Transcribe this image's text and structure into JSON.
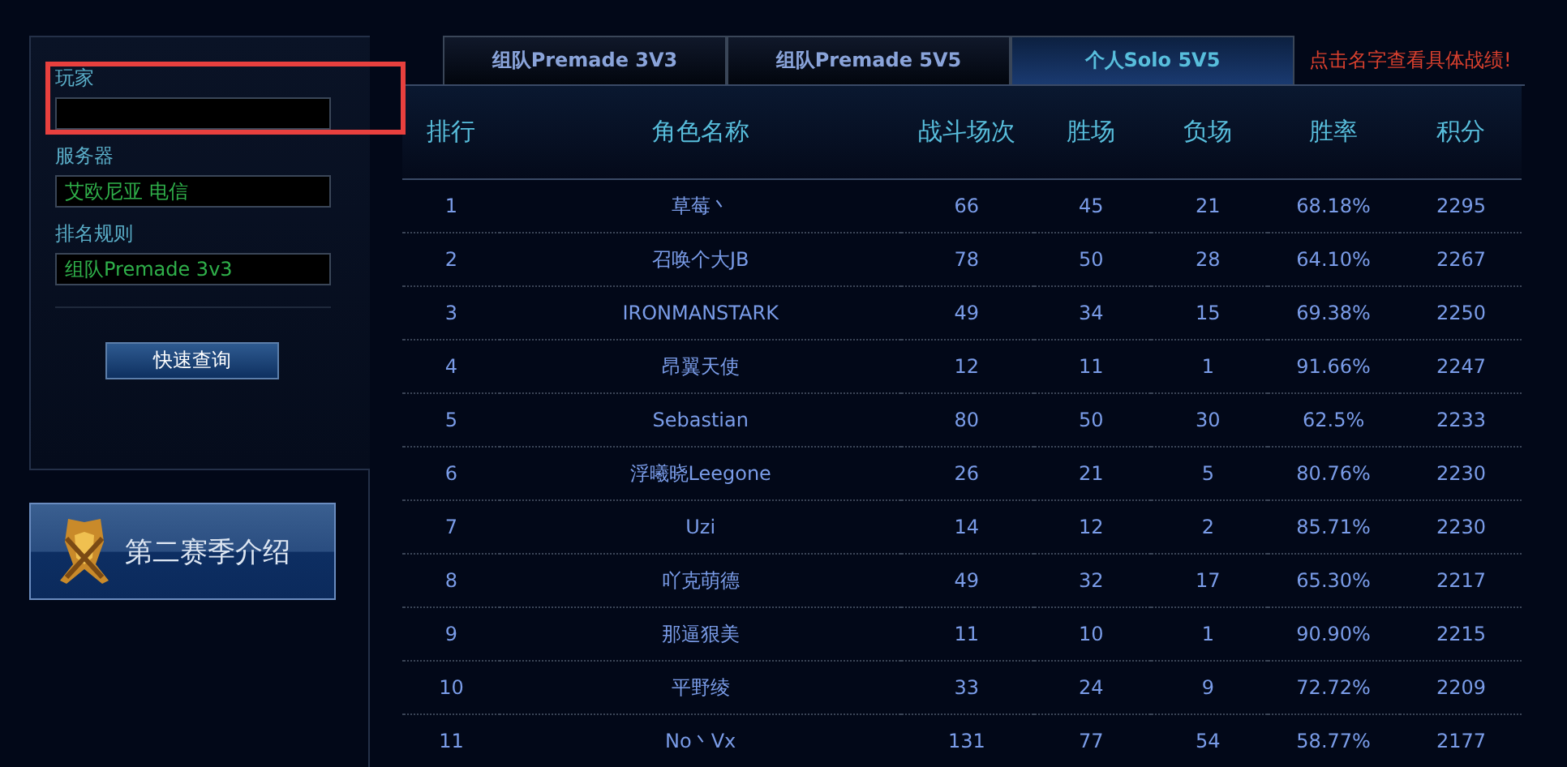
{
  "search_form": {
    "fields": [
      {
        "label": "玩家",
        "highlighted": true
      },
      {
        "label": "服务器",
        "value": "艾欧尼亚 电信",
        "highlighted": false
      },
      {
        "label": "排名规则",
        "value": "组队Premade 3v3",
        "highlighted": false
      }
    ],
    "button": "快速查询"
  },
  "season_intro": {
    "label": "第二赛季介绍"
  },
  "tabs": [
    {
      "label": "组队Premade 3V3",
      "selected": false
    },
    {
      "label": "组队Premade 5V5",
      "selected": false
    },
    {
      "label": "个人Solo 5V5",
      "selected": true
    }
  ],
  "hint": "点击名字查看具体战绩!",
  "table": {
    "columns": [
      "排行",
      "角色名称",
      "战斗场次",
      "胜场",
      "负场",
      "胜率",
      "积分"
    ],
    "rows": [
      [
        "1",
        "草莓丶",
        "66",
        "45",
        "21",
        "68.18%",
        "2295"
      ],
      [
        "2",
        "召唤个大JB",
        "78",
        "50",
        "28",
        "64.10%",
        "2267"
      ],
      [
        "3",
        "IRONMANSTARK",
        "49",
        "34",
        "15",
        "69.38%",
        "2250"
      ],
      [
        "4",
        "昂翼天使",
        "12",
        "11",
        "1",
        "91.66%",
        "2247"
      ],
      [
        "5",
        "Sebastian",
        "80",
        "50",
        "30",
        "62.5%",
        "2233"
      ],
      [
        "6",
        "浮曦晓Leegone",
        "26",
        "21",
        "5",
        "80.76%",
        "2230"
      ],
      [
        "7",
        "Uzi",
        "14",
        "12",
        "2",
        "85.71%",
        "2230"
      ],
      [
        "8",
        "吖克萌德",
        "49",
        "32",
        "17",
        "65.30%",
        "2217"
      ],
      [
        "9",
        "那逼狠美",
        "11",
        "10",
        "1",
        "90.90%",
        "2215"
      ],
      [
        "10",
        "平野绫",
        "33",
        "24",
        "9",
        "72.72%",
        "2209"
      ],
      [
        "11",
        "No丶Vx",
        "131",
        "77",
        "54",
        "58.77%",
        "2177"
      ]
    ]
  }
}
